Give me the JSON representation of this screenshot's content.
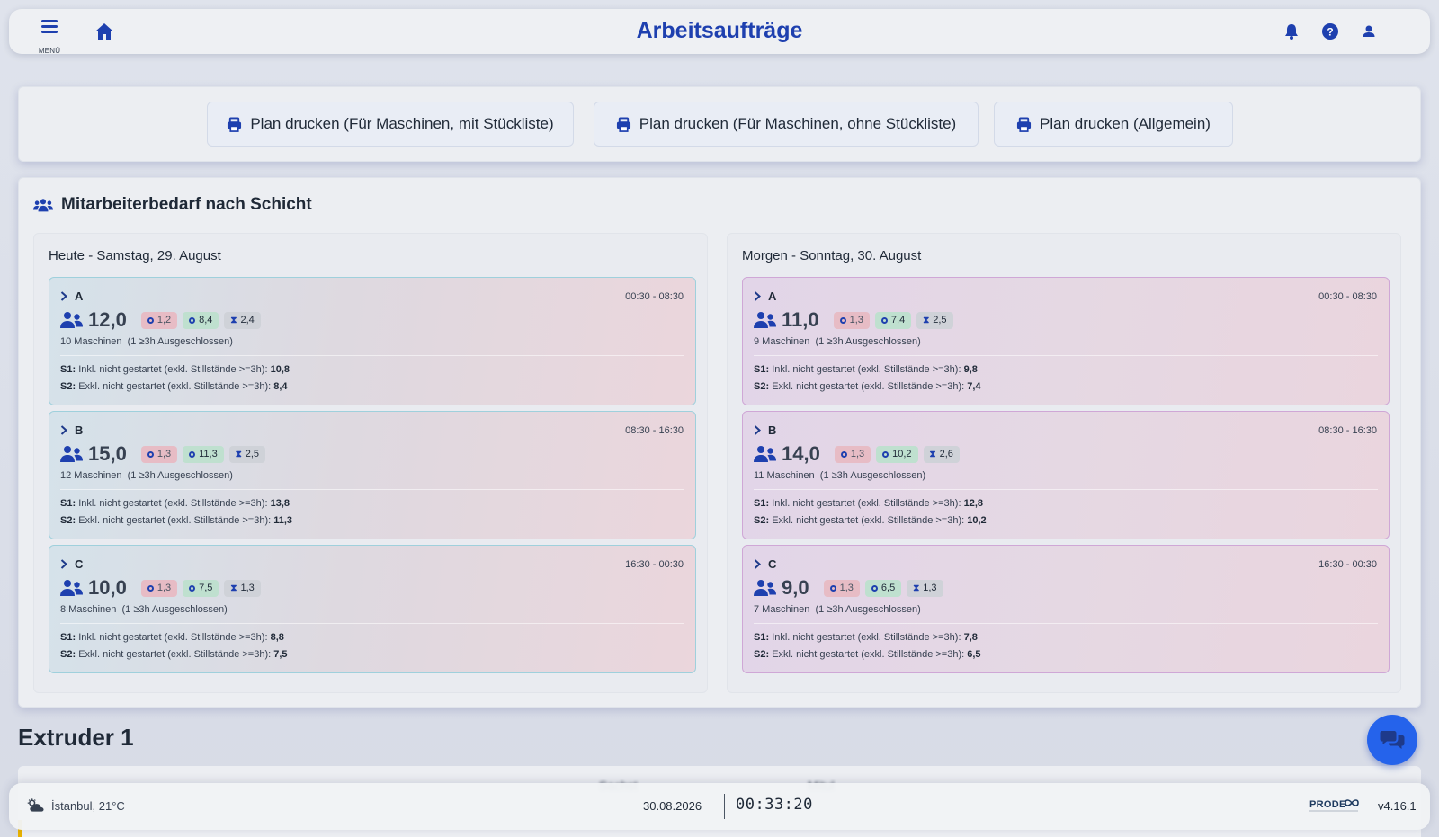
{
  "header": {
    "menu_label": "MENÜ",
    "title": "Arbeitsaufträge"
  },
  "print_buttons": [
    {
      "label": "Plan drucken (Für Maschinen, mit Stückliste)"
    },
    {
      "label": "Plan drucken (Für Maschinen, ohne Stückliste)"
    },
    {
      "label": "Plan drucken (Allgemein)"
    }
  ],
  "staff": {
    "title": "Mitarbeiterbedarf nach Schicht",
    "days": [
      {
        "title": "Heute - Samstag, 29. August",
        "shifts": [
          {
            "name": "A",
            "time": "00:30 - 08:30",
            "total": "12,0",
            "b1": "1,2",
            "b2": "8,4",
            "b3": "2,4",
            "machines": "10 Maschinen",
            "excluded": "(1 ≥3h Ausgeschlossen)",
            "s1_label": "S1:",
            "s1_text": "Inkl. nicht gestartet (exkl. Stillstände >=3h):",
            "s1_value": "10,8",
            "s2_label": "S2:",
            "s2_text": "Exkl. nicht gestartet (exkl. Stillstände >=3h):",
            "s2_value": "8,4"
          },
          {
            "name": "B",
            "time": "08:30 - 16:30",
            "total": "15,0",
            "b1": "1,3",
            "b2": "11,3",
            "b3": "2,5",
            "machines": "12 Maschinen",
            "excluded": "(1 ≥3h Ausgeschlossen)",
            "s1_label": "S1:",
            "s1_text": "Inkl. nicht gestartet (exkl. Stillstände >=3h):",
            "s1_value": "13,8",
            "s2_label": "S2:",
            "s2_text": "Exkl. nicht gestartet (exkl. Stillstände >=3h):",
            "s2_value": "11,3"
          },
          {
            "name": "C",
            "time": "16:30 - 00:30",
            "total": "10,0",
            "b1": "1,3",
            "b2": "7,5",
            "b3": "1,3",
            "machines": "8 Maschinen",
            "excluded": "(1 ≥3h Ausgeschlossen)",
            "s1_label": "S1:",
            "s1_text": "Inkl. nicht gestartet (exkl. Stillstände >=3h):",
            "s1_value": "8,8",
            "s2_label": "S2:",
            "s2_text": "Exkl. nicht gestartet (exkl. Stillstände >=3h):",
            "s2_value": "7,5"
          }
        ]
      },
      {
        "title": "Morgen - Sonntag, 30. August",
        "shifts": [
          {
            "name": "A",
            "time": "00:30 - 08:30",
            "total": "11,0",
            "b1": "1,3",
            "b2": "7,4",
            "b3": "2,5",
            "machines": "9 Maschinen",
            "excluded": "(1 ≥3h Ausgeschlossen)",
            "s1_label": "S1:",
            "s1_text": "Inkl. nicht gestartet (exkl. Stillstände >=3h):",
            "s1_value": "9,8",
            "s2_label": "S2:",
            "s2_text": "Exkl. nicht gestartet (exkl. Stillstände >=3h):",
            "s2_value": "7,4"
          },
          {
            "name": "B",
            "time": "08:30 - 16:30",
            "total": "14,0",
            "b1": "1,3",
            "b2": "10,2",
            "b3": "2,6",
            "machines": "11 Maschinen",
            "excluded": "(1 ≥3h Ausgeschlossen)",
            "s1_label": "S1:",
            "s1_text": "Inkl. nicht gestartet (exkl. Stillstände >=3h):",
            "s1_value": "12,8",
            "s2_label": "S2:",
            "s2_text": "Exkl. nicht gestartet (exkl. Stillstände >=3h):",
            "s2_value": "10,2"
          },
          {
            "name": "C",
            "time": "16:30 - 00:30",
            "total": "9,0",
            "b1": "1,3",
            "b2": "6,5",
            "b3": "1,3",
            "machines": "7 Maschinen",
            "excluded": "(1 ≥3h Ausgeschlossen)",
            "s1_label": "S1:",
            "s1_text": "Inkl. nicht gestartet (exkl. Stillstände >=3h):",
            "s1_value": "7,8",
            "s2_label": "S2:",
            "s2_text": "Exkl. nicht gestartet (exkl. Stillstände >=3h):",
            "s2_value": "6,5"
          }
        ]
      }
    ]
  },
  "extruder": {
    "title": "Extruder 1",
    "col1": "Sachst",
    "col2": "Mitul"
  },
  "footer": {
    "weather": "İstanbul, 21°C",
    "date": "30.08.2026",
    "clock": "00:33:20",
    "logo": "PRODECO",
    "version": "v4.16.1"
  },
  "colors": {
    "accent": "#1e40af",
    "fab": "#2563eb",
    "badge_red": "#e7bcc5",
    "badge_green": "#bfe0cf",
    "badge_gray": "#cfd2d8"
  }
}
